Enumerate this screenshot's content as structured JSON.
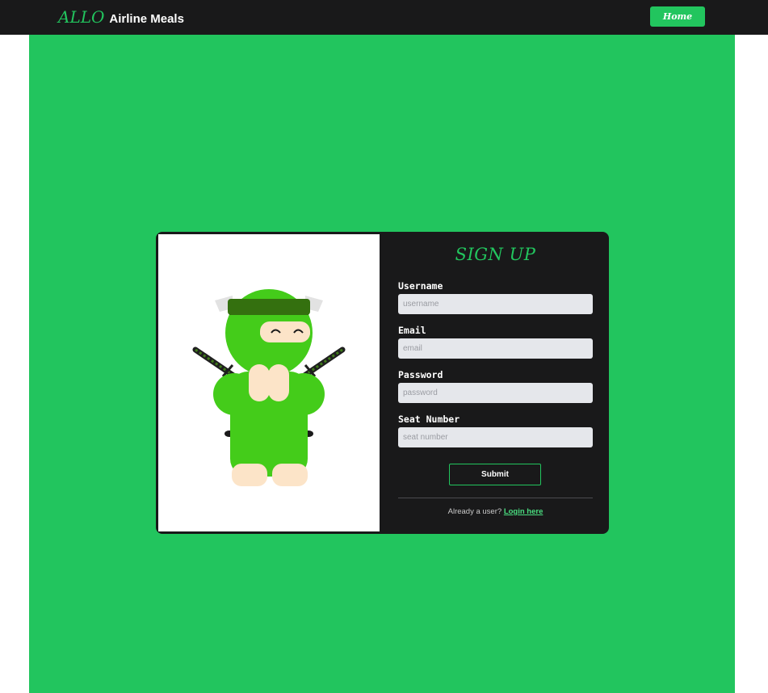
{
  "navbar": {
    "brand_allo": "ALLO",
    "brand_name": "Airline Meals",
    "home_label": "Home"
  },
  "signup": {
    "title": "SIGN UP",
    "fields": [
      {
        "label": "Username",
        "placeholder": "username"
      },
      {
        "label": "Email",
        "placeholder": "email"
      },
      {
        "label": "Password",
        "placeholder": "password"
      },
      {
        "label": "Seat Number",
        "placeholder": "seat number"
      }
    ],
    "submit_label": "Submit",
    "already_text": "Already a user?",
    "login_link": "Login here"
  },
  "colors": {
    "accent": "#22c55e",
    "dark": "#19191a",
    "input_bg": "#e5e7eb"
  },
  "illustration": {
    "name": "ninja-mascot"
  }
}
